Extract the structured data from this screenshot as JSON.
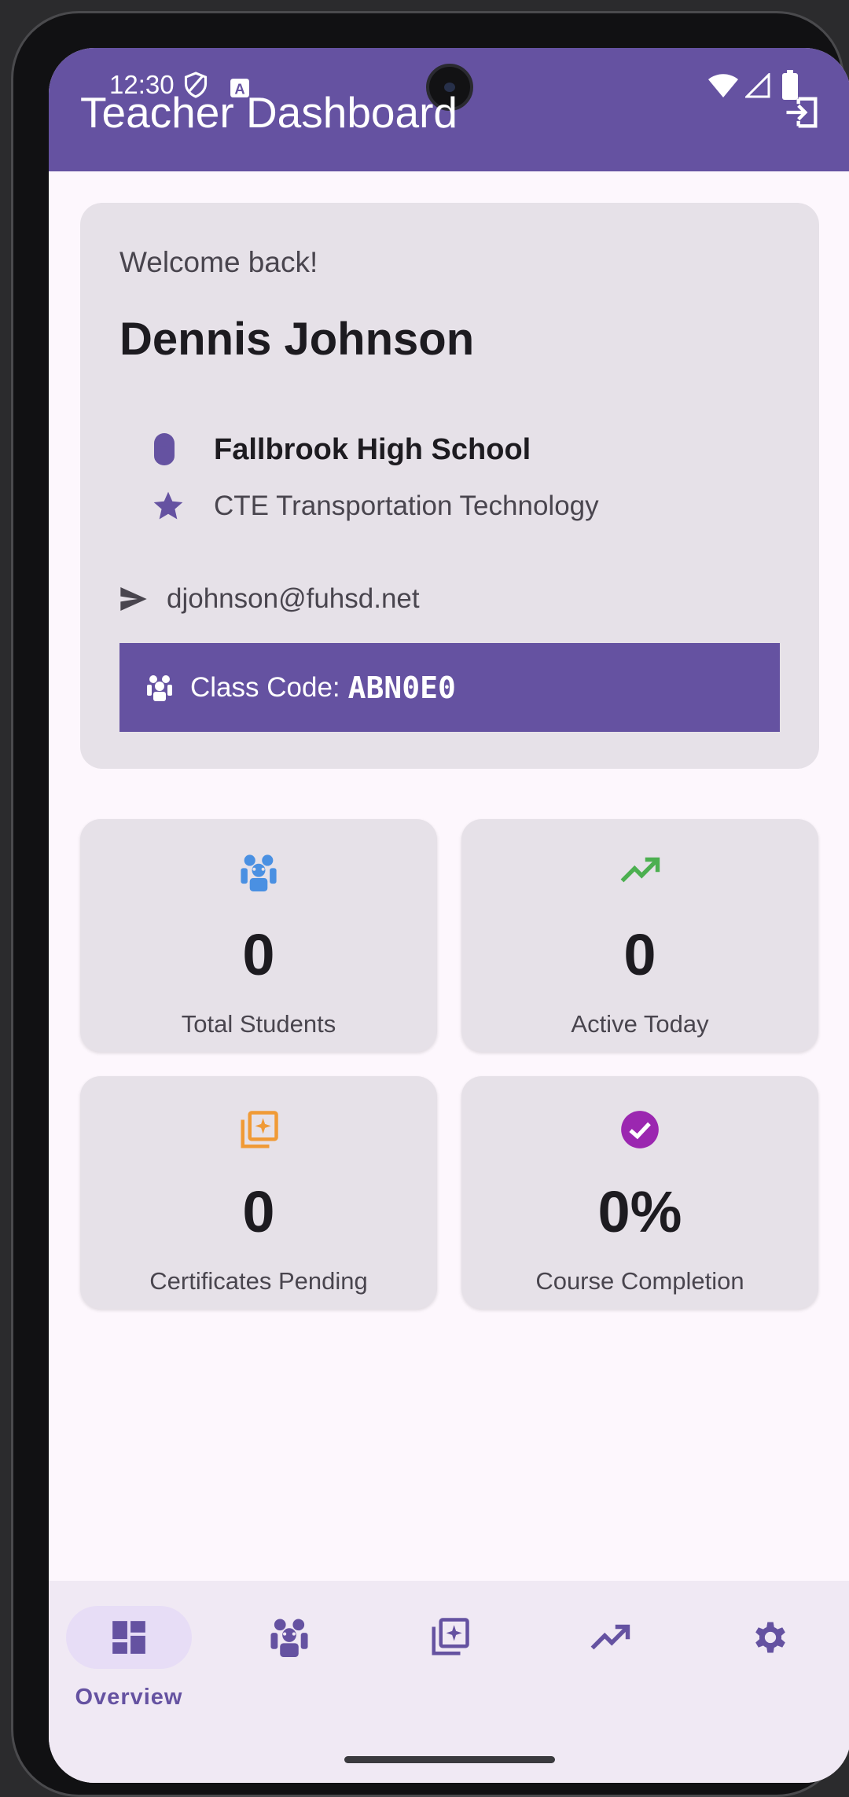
{
  "status_bar": {
    "time": "12:30",
    "icons": [
      "shield-icon",
      "notification-a-icon",
      "wifi-icon",
      "signal-icon",
      "battery-icon"
    ]
  },
  "app_bar": {
    "title": "Teacher Dashboard",
    "logout_icon": "logout-icon"
  },
  "welcome": {
    "greeting": "Welcome back!",
    "name": "Dennis Johnson",
    "school": "Fallbrook High School",
    "program": "CTE Transportation Technology",
    "email": "djohnson@fuhsd.net",
    "class_code_label": "Class Code:",
    "class_code": "ABN0E0"
  },
  "stats": [
    {
      "value": "0",
      "label": "Total Students",
      "icon": "students-icon",
      "color": "#4a90e2"
    },
    {
      "value": "0",
      "label": "Active Today",
      "icon": "trending-up-icon",
      "color": "#4caf50"
    },
    {
      "value": "0",
      "label": "Certificates Pending",
      "icon": "certificate-icon",
      "color": "#f09a36"
    },
    {
      "value": "0%",
      "label": "Course Completion",
      "icon": "check-circle-icon",
      "color": "#9b27b0"
    }
  ],
  "bottom_nav": {
    "items": [
      {
        "label": "Overview",
        "icon": "dashboard-icon",
        "active": true
      },
      {
        "label": "",
        "icon": "students-icon",
        "active": false
      },
      {
        "label": "",
        "icon": "certificate-icon",
        "active": false
      },
      {
        "label": "",
        "icon": "trending-up-icon",
        "active": false
      },
      {
        "label": "",
        "icon": "gear-icon",
        "active": false
      }
    ]
  },
  "colors": {
    "primary": "#6552a1",
    "card": "#e6e1e8",
    "background": "#fdf7fd"
  }
}
